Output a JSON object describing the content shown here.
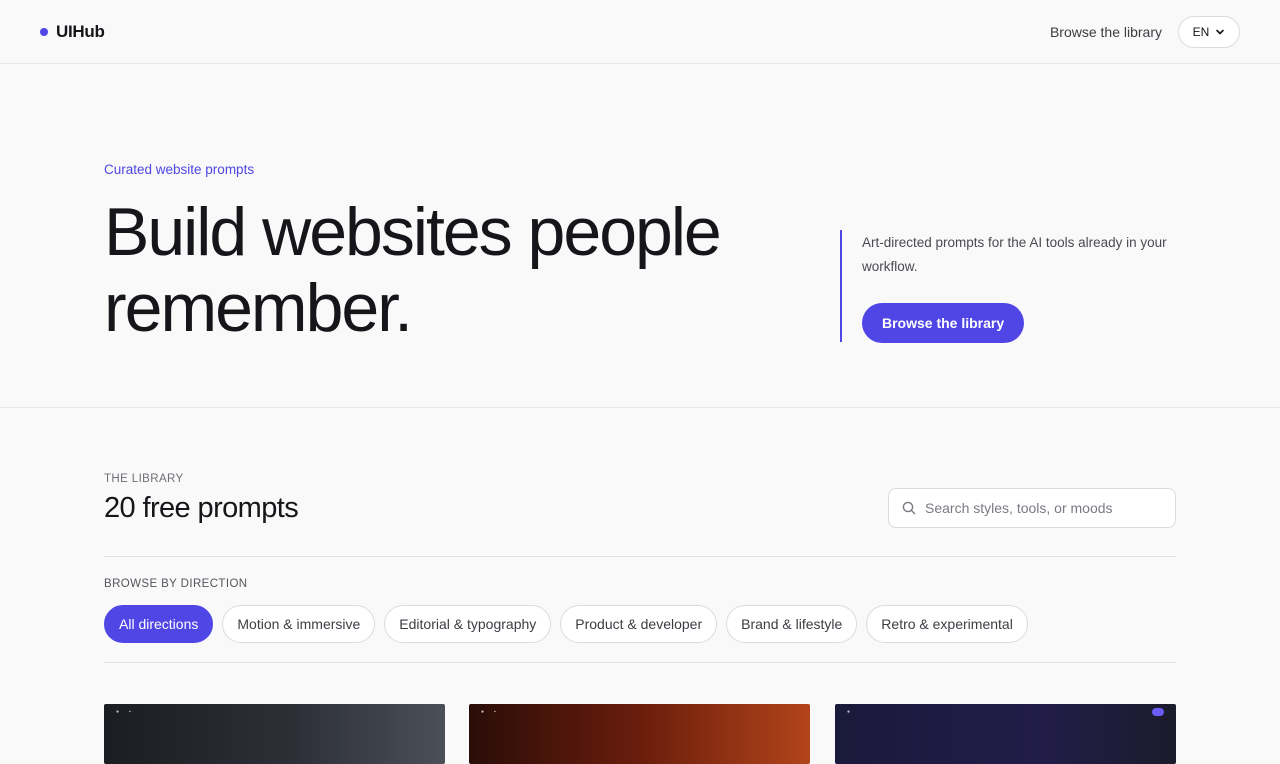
{
  "header": {
    "brand": "UIHub",
    "nav_link": "Browse the library",
    "language": "EN"
  },
  "hero": {
    "eyebrow": "Curated website prompts",
    "title_line1": "Build websites people",
    "title_line2": "remember.",
    "description": "Art-directed prompts for the AI tools already in your workflow.",
    "cta": "Browse the library"
  },
  "library": {
    "label": "THE LIBRARY",
    "title": "20 free prompts",
    "search_placeholder": "Search styles, tools, or moods"
  },
  "filters": {
    "label": "BROWSE BY DIRECTION",
    "items": [
      {
        "label": "All directions",
        "active": true
      },
      {
        "label": "Motion & immersive",
        "active": false
      },
      {
        "label": "Editorial & typography",
        "active": false
      },
      {
        "label": "Product & developer",
        "active": false
      },
      {
        "label": "Brand & lifestyle",
        "active": false
      },
      {
        "label": "Retro & experimental",
        "active": false
      }
    ]
  },
  "colors": {
    "accent": "#4f46e5",
    "background": "#f9f9f9",
    "text": "#16161a"
  }
}
